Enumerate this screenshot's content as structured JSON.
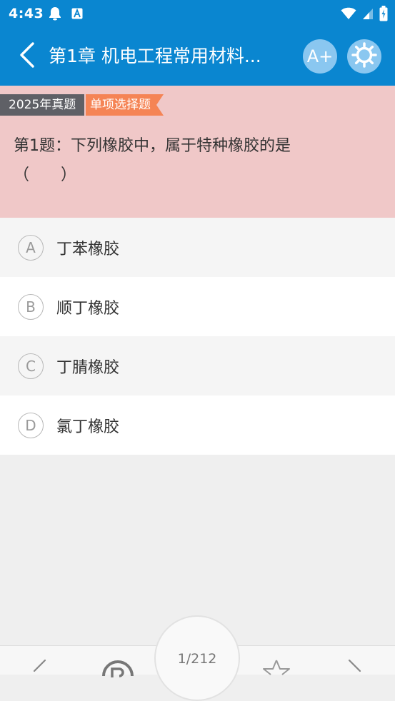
{
  "status_bar": {
    "time": "4:43",
    "left_icons": [
      "qq-bell-icon",
      "a-notification-icon"
    ],
    "right_icons": [
      "wifi-icon",
      "cell-signal-icon",
      "battery-icon"
    ]
  },
  "app_bar": {
    "back_icon": "back-chevron-icon",
    "title": "第1章 机电工程常用材料...",
    "font_button_label": "A+",
    "settings_icon": "settings-gear-icon",
    "bg_color": "#0a86d0"
  },
  "question": {
    "year_tag": "2025年真题",
    "type_tag": "单项选择题",
    "text_line1": "第1题：下列橡胶中，属于特种橡胶的是",
    "text_line2": "（　　）"
  },
  "options": [
    {
      "letter": "A",
      "text": "丁苯橡胶"
    },
    {
      "letter": "B",
      "text": "顺丁橡胶"
    },
    {
      "letter": "C",
      "text": "丁腈橡胶"
    },
    {
      "letter": "D",
      "text": "氯丁橡胶"
    }
  ],
  "bottom_bar": {
    "page_indicator": "1/212",
    "icons": [
      "prev-chevron-icon",
      "answer-card-icon",
      "favorite-star-icon",
      "next-chevron-icon"
    ]
  }
}
